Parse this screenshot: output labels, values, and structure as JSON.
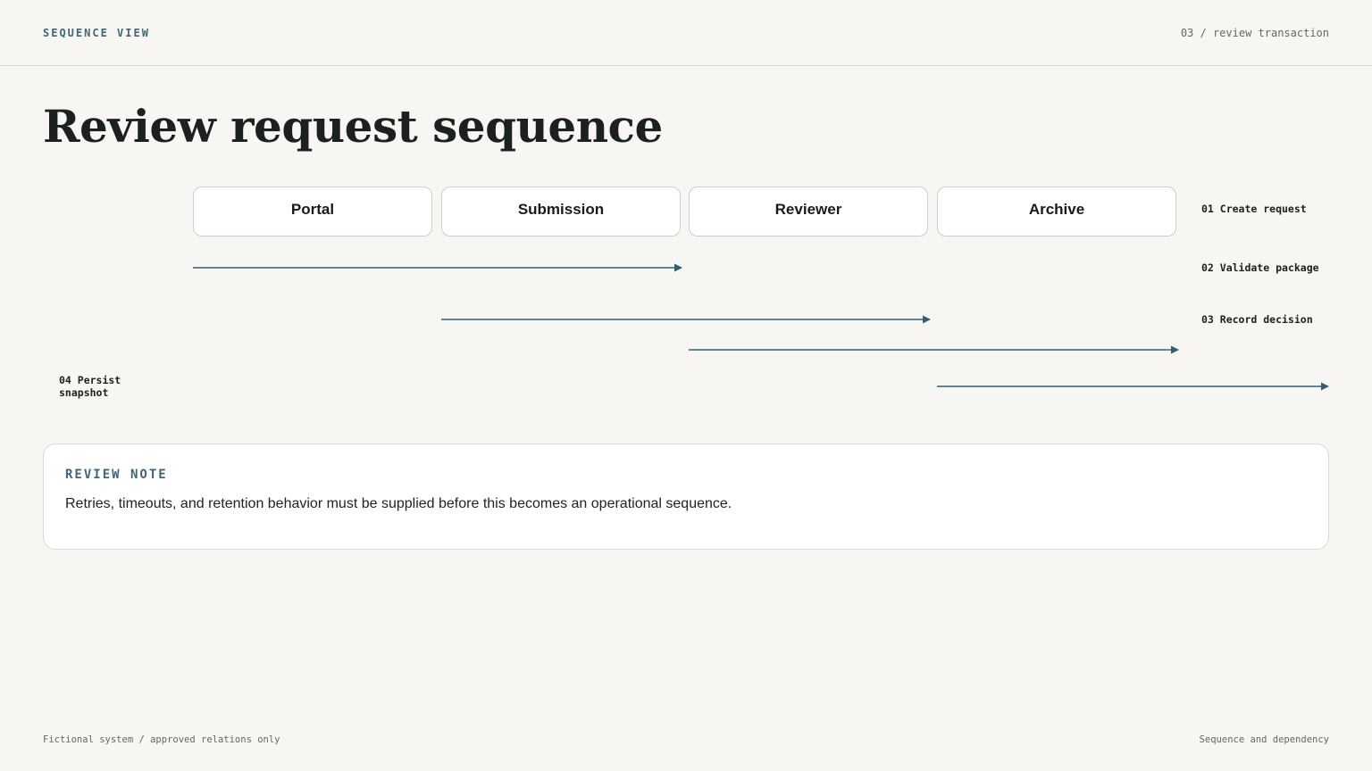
{
  "header": {
    "label": "SEQUENCE VIEW",
    "section": "03 / review transaction"
  },
  "title": "Review request sequence",
  "participants": [
    "Portal",
    "Submission",
    "Reviewer",
    "Archive"
  ],
  "steps": [
    {
      "label": "01 Create request",
      "from": "Portal",
      "to": "Reviewer"
    },
    {
      "label": "02 Validate package",
      "from": "Submission",
      "to": "Archive"
    },
    {
      "label": "03 Record decision",
      "from": "Reviewer",
      "to": "Archive"
    },
    {
      "label": "04 Persist snapshot",
      "from": "Archive",
      "to": "Archive"
    }
  ],
  "note": {
    "heading": "REVIEW NOTE",
    "body": "Retries, timeouts, and retention behavior must be supplied before this becomes an operational sequence."
  },
  "footer": {
    "left": "Fictional system / approved relations only",
    "right": "Sequence and dependency"
  },
  "colors": {
    "accent": "#3f6677",
    "arrow": "#2f5f70",
    "background": "#f7f6f2",
    "title": "#1a211e"
  }
}
